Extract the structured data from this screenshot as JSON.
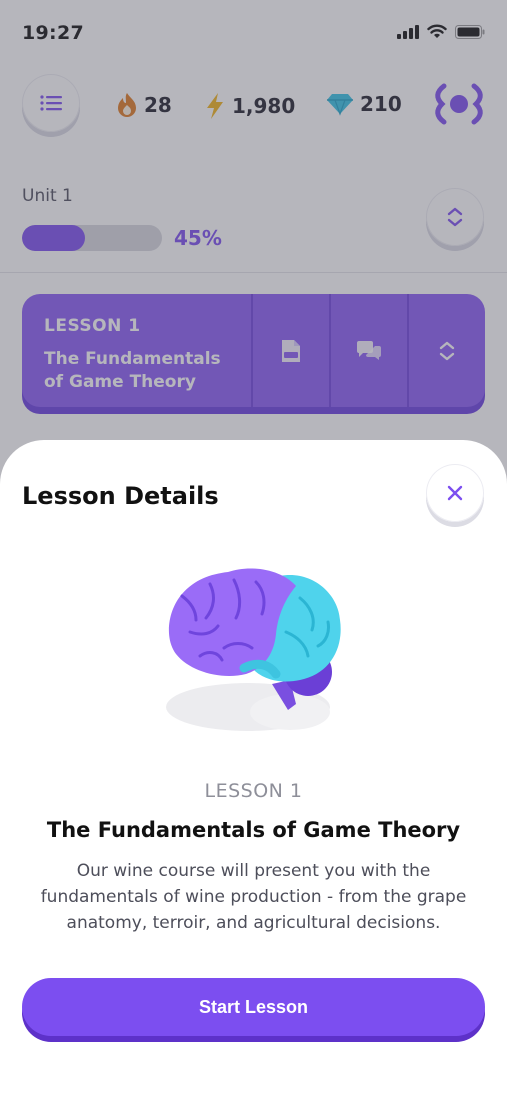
{
  "status": {
    "time": "19:27"
  },
  "stats": {
    "streak": "28",
    "xp": "1,980",
    "gems": "210"
  },
  "unit": {
    "label": "Unit 1",
    "progress_text": "45%",
    "progress": 0.45
  },
  "lesson_card": {
    "number": "LESSON 1",
    "title": "The Fundamentals of Game Theory"
  },
  "sheet": {
    "title": "Lesson Details",
    "lesson_number": "LESSON 1",
    "lesson_title": "The Fundamentals of Game Theory",
    "description": "Our wine course will present you with the fundamentals of wine production - from the grape anatomy, terroir, and agricultural decisions.",
    "button_label": "Start Lesson"
  },
  "colors": {
    "accent": "#7c4ef0",
    "card": "#8a5cf5",
    "streak": "#e07a22",
    "xp": "#f2b41b",
    "gem": "#34c3e6"
  },
  "icons": [
    "list-icon",
    "flame-icon",
    "bolt-icon",
    "gem-icon",
    "logo-icon",
    "chevron-up-down-icon",
    "pdf-icon",
    "chat-icon",
    "close-icon",
    "brain-illustration"
  ]
}
